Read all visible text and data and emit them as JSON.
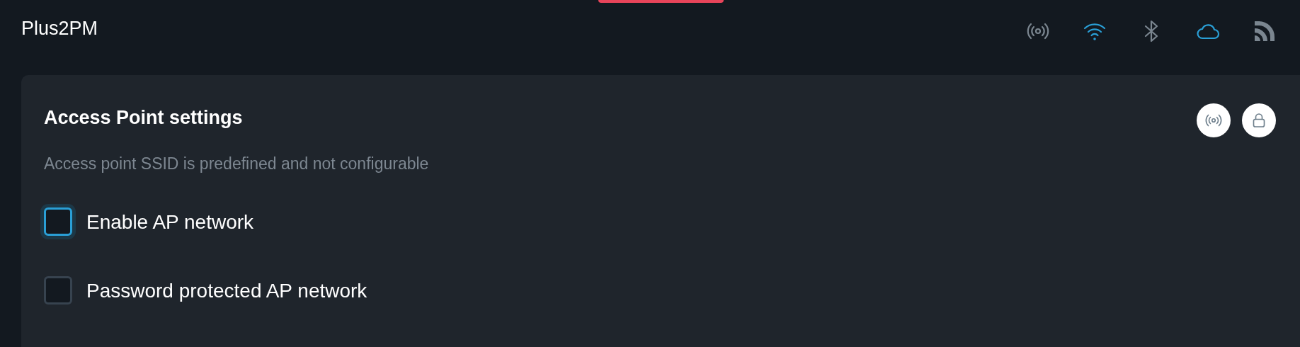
{
  "header": {
    "title": "Plus2PM",
    "status_icons": [
      {
        "kind": "ap",
        "active": false
      },
      {
        "kind": "wifi",
        "active": true
      },
      {
        "kind": "bluetooth",
        "active": false
      },
      {
        "kind": "cloud",
        "active": true
      },
      {
        "kind": "rss",
        "active": false
      }
    ]
  },
  "card": {
    "title": "Access Point settings",
    "subtitle": "Access point SSID is predefined and not configurable",
    "badges": [
      {
        "kind": "ap"
      },
      {
        "kind": "lock"
      }
    ],
    "options": [
      {
        "label": "Enable AP network",
        "checked": false,
        "focused": true
      },
      {
        "label": "Password protected AP network",
        "checked": false,
        "focused": false
      }
    ]
  }
}
